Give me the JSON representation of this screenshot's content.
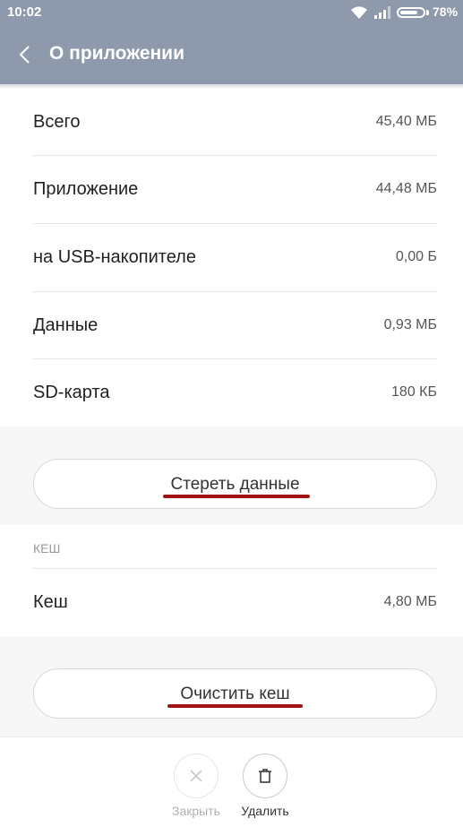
{
  "status_bar": {
    "time": "10:02",
    "battery": "78%",
    "battery_level": 0.78
  },
  "app_bar": {
    "title": "О приложении",
    "back_icon": "chevron-left-icon"
  },
  "storage": [
    {
      "label": "Всего",
      "value": "45,40 МБ"
    },
    {
      "label": "Приложение",
      "value": "44,48 МБ"
    },
    {
      "label": "на USB-накопителе",
      "value": "0,00 Б"
    },
    {
      "label": "Данные",
      "value": "0,93 МБ"
    },
    {
      "label": "SD-карта",
      "value": "180 КБ"
    }
  ],
  "clear_data_button": "Стереть данные",
  "cache_section": {
    "header": "КЕШ",
    "label": "Кеш",
    "value": "4,80 МБ"
  },
  "clear_cache_button": "Очистить кеш",
  "bottom_actions": {
    "close_label": "Закрыть",
    "delete_label": "Удалить"
  },
  "colors": {
    "header": "#8e99ac",
    "annotation": "#a11414",
    "disabled": "#b0b0b0"
  }
}
